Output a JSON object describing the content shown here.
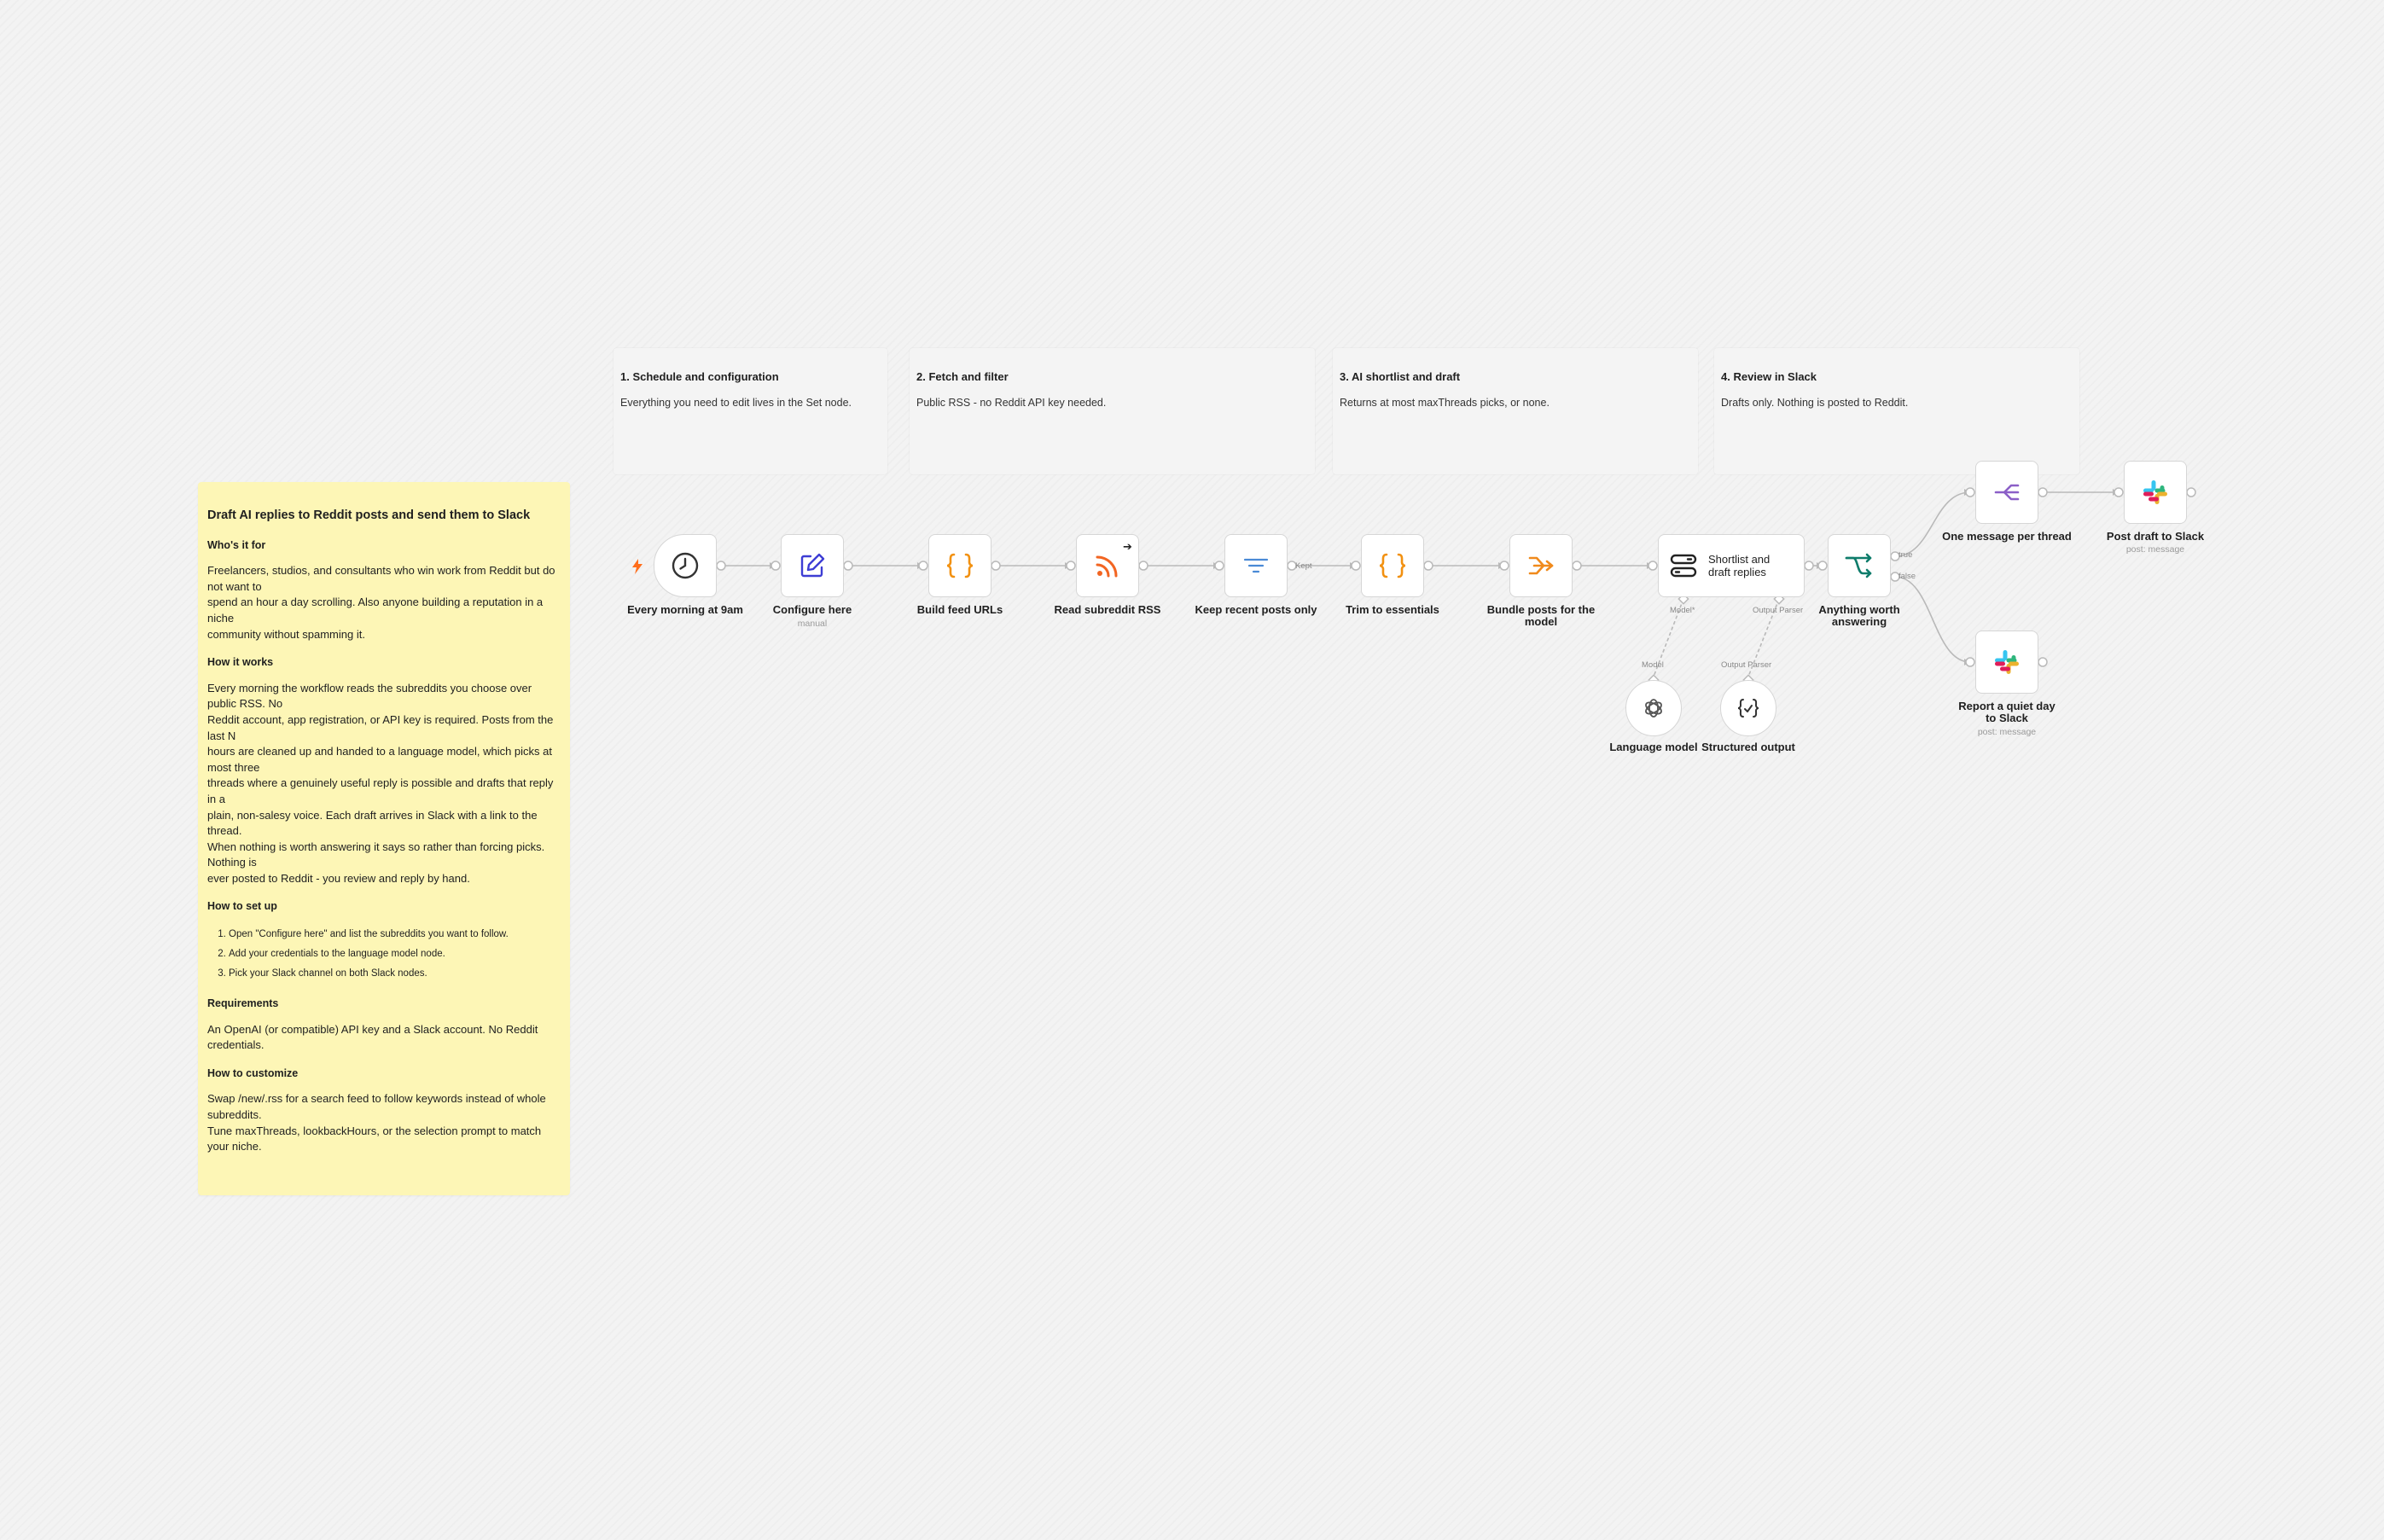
{
  "sections": [
    {
      "title": "1. Schedule and configuration",
      "text": "Everything you need to edit lives in the Set node."
    },
    {
      "title": "2. Fetch and filter",
      "text": "Public RSS - no Reddit API key needed."
    },
    {
      "title": "3. AI shortlist and draft",
      "text": "Returns at most maxThreads picks, or none."
    },
    {
      "title": "4. Review in Slack",
      "text": "Drafts only. Nothing is posted to Reddit."
    }
  ],
  "sticky": {
    "title": "Draft AI replies to Reddit posts and send them to Slack",
    "who_heading": "Who's it for",
    "who_text": "Freelancers, studios, and consultants who win work from Reddit but do not want to\nspend an hour a day scrolling. Also anyone building a reputation in a niche\ncommunity without spamming it.",
    "how_heading": "How it works",
    "how_text": "Every morning the workflow reads the subreddits you choose over public RSS. No\nReddit account, app registration, or API key is required. Posts from the last N\nhours are cleaned up and handed to a language model, which picks at most three\nthreads where a genuinely useful reply is possible and drafts that reply in a\nplain, non-salesy voice. Each draft arrives in Slack with a link to the thread.\nWhen nothing is worth answering it says so rather than forcing picks. Nothing is\never posted to Reddit - you review and reply by hand.",
    "setup_heading": "How to set up",
    "setup_steps": [
      "Open \"Configure here\" and list the subreddits you want to follow.",
      "Add your credentials to the language model node.",
      "Pick your Slack channel on both Slack nodes."
    ],
    "req_heading": "Requirements",
    "req_text": "An OpenAI (or compatible) API key and a Slack account. No Reddit credentials.",
    "custom_heading": "How to customize",
    "custom_text": "Swap /new/.rss for a search feed to follow keywords instead of whole subreddits.\nTune maxThreads, lookbackHours, or the selection prompt to match your niche."
  },
  "nodes": {
    "schedule": {
      "label": "Every morning at 9am",
      "icon": "clock-icon"
    },
    "configure": {
      "label": "Configure here",
      "sub": "manual",
      "icon": "pencil-edit-icon"
    },
    "build_urls": {
      "label": "Build feed URLs",
      "icon": "code-braces-icon"
    },
    "read_rss": {
      "label": "Read subreddit RSS",
      "icon": "rss-icon"
    },
    "keep_recent": {
      "label": "Keep recent posts only",
      "icon": "filter-icon",
      "port": "Kept"
    },
    "trim": {
      "label": "Trim to essentials",
      "icon": "code-braces-icon"
    },
    "bundle": {
      "label": "Bundle posts for the model",
      "icon": "aggregate-icon"
    },
    "shortlist": {
      "label": "Shortlist and draft replies",
      "icon": "agent-icon",
      "model_port": "Model*",
      "parser_port": "Output Parser"
    },
    "anything": {
      "label": "Anything worth answering",
      "icon": "if-branch-icon",
      "true_label": "true",
      "false_label": "false"
    },
    "split": {
      "label": "One message per thread",
      "icon": "split-out-icon"
    },
    "post_draft": {
      "label": "Post draft to Slack",
      "sub": "post: message",
      "icon": "slack-icon"
    },
    "quiet_day": {
      "label": "Report a quiet day to Slack",
      "sub": "post: message",
      "icon": "slack-icon"
    },
    "language_model": {
      "label": "Language model",
      "port": "Model",
      "icon": "openai-icon"
    },
    "structured": {
      "label": "Structured output",
      "port": "Output Parser",
      "icon": "json-parser-icon"
    }
  },
  "colors": {
    "orange": "#ff6d1b",
    "indigo": "#3d3dd4",
    "filter_blue": "#4a8ad6",
    "teal": "#0e7c6b",
    "purple": "#8b5fc7",
    "sticky_yellow": "#fdf6b6"
  }
}
